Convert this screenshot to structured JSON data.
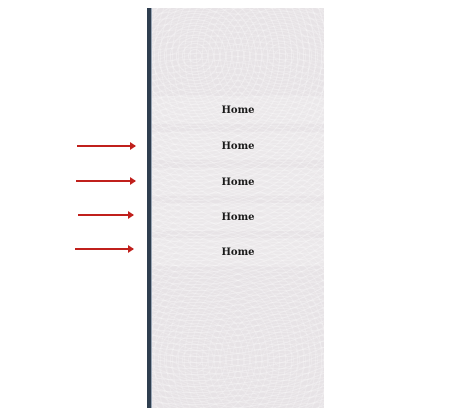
{
  "menu": {
    "items": [
      {
        "label": "Home"
      },
      {
        "label": "Home"
      },
      {
        "label": "Home"
      },
      {
        "label": "Home"
      },
      {
        "label": "Home"
      }
    ]
  },
  "arrows": {
    "color": "#c0201c",
    "count": 4
  },
  "colors": {
    "panel_background": "#e7e3e6",
    "border": "#2f3e4f",
    "text": "#1a1a1a"
  }
}
